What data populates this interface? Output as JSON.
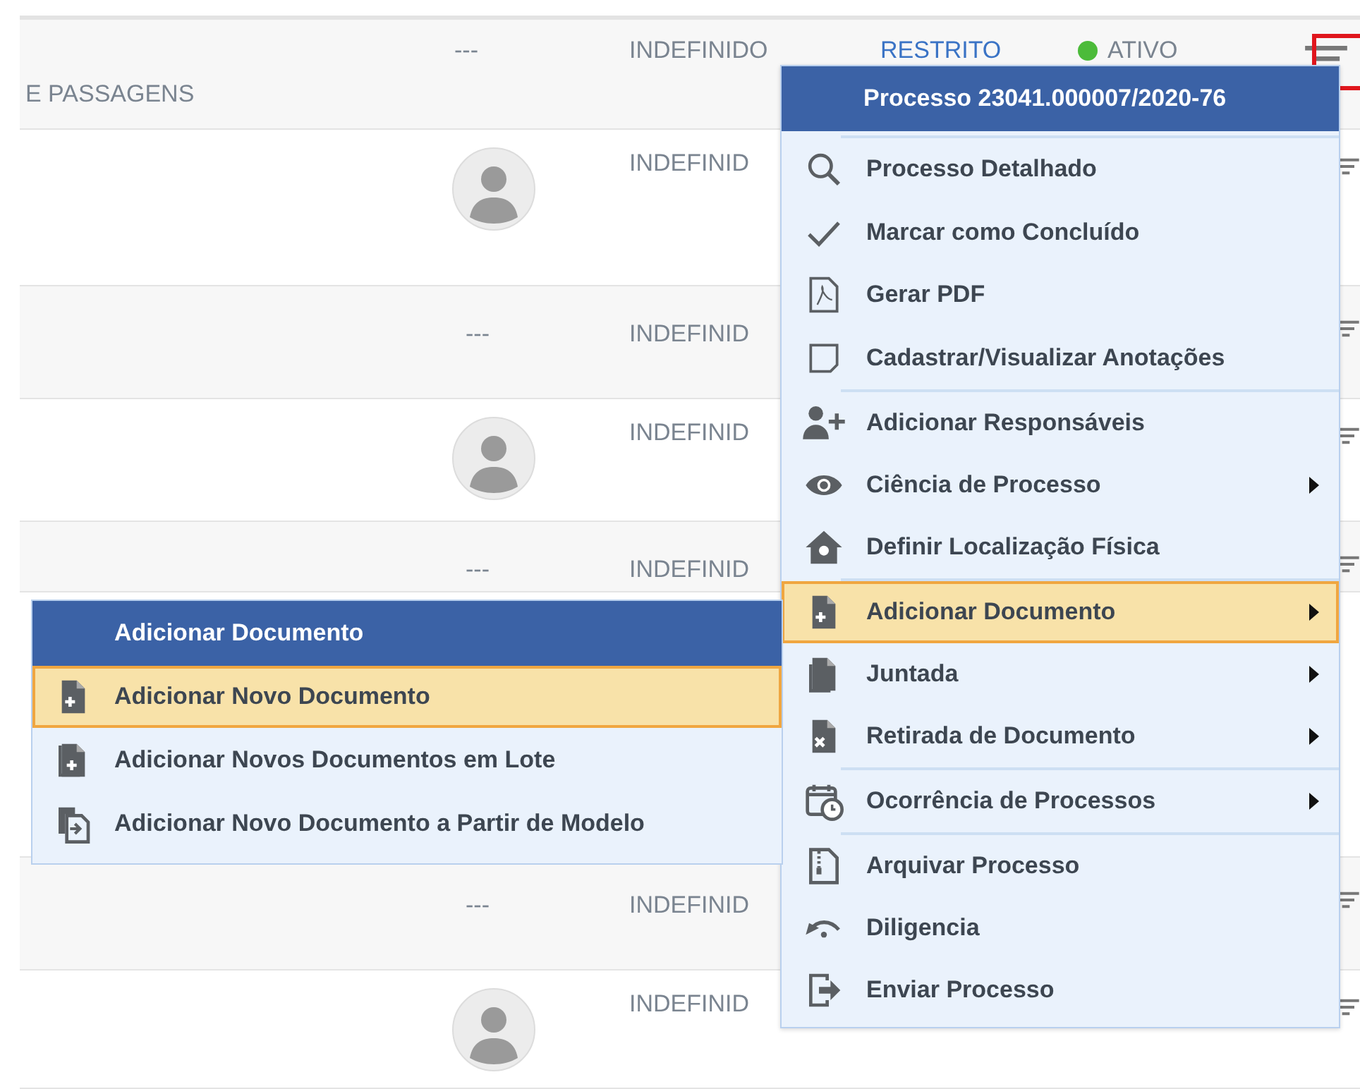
{
  "rows": [
    {
      "kind": "title",
      "name": "E PASSAGENS",
      "reference": "---",
      "status": "INDEFINIDO",
      "access": "RESTRITO",
      "state": "ATIVO",
      "color": "#4cbb3a"
    },
    {
      "kind": "avatar",
      "status": "INDEFINID"
    },
    {
      "kind": "dash",
      "reference": "---",
      "status": "INDEFINID"
    },
    {
      "kind": "avatar",
      "status": "INDEFINID"
    },
    {
      "kind": "dash",
      "reference": "---",
      "status": "INDEFINID"
    },
    {
      "kind": "blank"
    },
    {
      "kind": "dash",
      "reference": "---",
      "status": "INDEFINID"
    },
    {
      "kind": "avatar",
      "status": "INDEFINID"
    }
  ],
  "context_menu": {
    "title": "Processo 23041.000007/2020-76",
    "groups": [
      [
        {
          "label": "Processo Detalhado",
          "submenu": false,
          "selected": false
        },
        {
          "label": "Marcar como Concluído",
          "submenu": false,
          "selected": false
        },
        {
          "label": "Gerar PDF",
          "submenu": false,
          "selected": false
        },
        {
          "label": "Cadastrar/Visualizar Anotações",
          "submenu": false,
          "selected": false
        }
      ],
      [
        {
          "label": "Adicionar Responsáveis",
          "submenu": false,
          "selected": false
        },
        {
          "label": "Ciência de Processo",
          "submenu": true,
          "selected": false
        },
        {
          "label": "Definir Localização Física",
          "submenu": false,
          "selected": false
        }
      ],
      [
        {
          "label": "Adicionar Documento",
          "submenu": true,
          "selected": true
        },
        {
          "label": "Juntada",
          "submenu": true,
          "selected": false
        },
        {
          "label": "Retirada de Documento",
          "submenu": true,
          "selected": false
        }
      ],
      [
        {
          "label": "Ocorrência de Processos",
          "submenu": true,
          "selected": false
        }
      ],
      [
        {
          "label": "Arquivar Processo",
          "submenu": false,
          "selected": false
        },
        {
          "label": "Diligencia",
          "submenu": false,
          "selected": false
        },
        {
          "label": "Enviar Processo",
          "submenu": false,
          "selected": false
        }
      ]
    ]
  },
  "submenu": {
    "title": "Adicionar Documento",
    "items": [
      {
        "label": "Adicionar Novo Documento",
        "selected": true
      },
      {
        "label": "Adicionar Novos Documentos em Lote",
        "selected": false
      },
      {
        "label": "Adicionar Novo Documento a Partir de Modelo",
        "selected": false
      }
    ]
  }
}
